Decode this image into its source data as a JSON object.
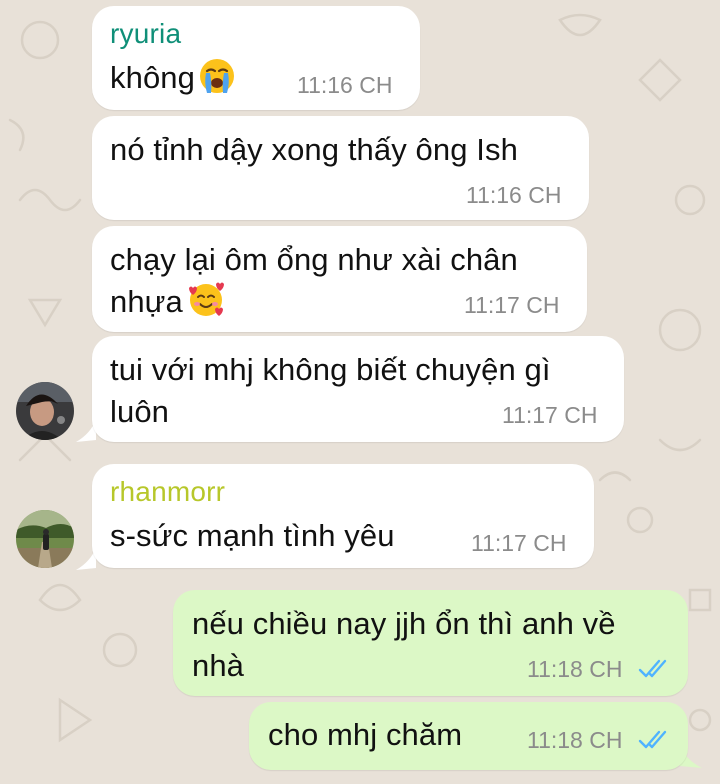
{
  "colors": {
    "background": "#e8e1d8",
    "incoming_bubble": "#ffffff",
    "outgoing_bubble": "#dcf8c6",
    "sender_ryuria": "#0f8f78",
    "sender_rhanmorr": "#b7c72a",
    "read_ticks": "#4fb3ff"
  },
  "messages": [
    {
      "sender": "ryuria",
      "text": "không",
      "emoji": "loudly-crying-face",
      "time": "11:16 CH"
    },
    {
      "text": "nó tỉnh dậy xong thấy ông Ish",
      "time": "11:16 CH"
    },
    {
      "line1": "chạy lại ôm ổng như xài chân",
      "line2": "nhựa",
      "emoji": "smiling-face-with-hearts",
      "time": "11:17 CH"
    },
    {
      "line1": "tui với mhj không biết chuyện gì",
      "line2": "luôn",
      "time": "11:17 CH"
    },
    {
      "sender": "rhanmorr",
      "text": "s-sức mạnh tình yêu",
      "time": "11:17 CH"
    },
    {
      "line1": "nếu chiều nay jjh ổn thì anh về",
      "line2": "nhà",
      "time": "11:18 CH",
      "status": "read"
    },
    {
      "text": "cho mhj chăm",
      "time": "11:18 CH",
      "status": "read"
    }
  ]
}
